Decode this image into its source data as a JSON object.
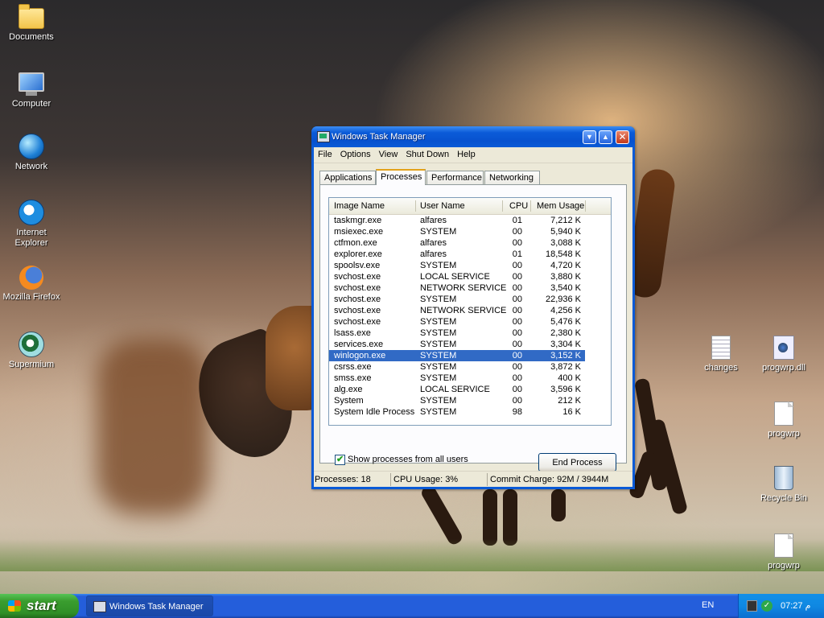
{
  "desktop": {
    "left_icons": [
      {
        "label": "Documents",
        "icon": "folder-icon"
      },
      {
        "label": "Computer",
        "icon": "computer-icon"
      },
      {
        "label": "Network",
        "icon": "network-icon"
      },
      {
        "label": "Internet Explorer",
        "icon": "internet-explorer-icon"
      },
      {
        "label": "Mozilla Firefox",
        "icon": "firefox-icon"
      },
      {
        "label": "Supermium",
        "icon": "supermium-icon"
      }
    ],
    "right_icons": [
      {
        "label": "changes",
        "icon": "text-document-icon"
      },
      {
        "label": "progwrp.dll",
        "icon": "dll-file-icon"
      },
      {
        "label": "progwrp",
        "icon": "document-icon"
      },
      {
        "label": "Recycle Bin",
        "icon": "recycle-bin-icon"
      },
      {
        "label": "progwrp",
        "icon": "document-icon"
      }
    ]
  },
  "window": {
    "title": "Windows Task Manager",
    "menu": [
      "File",
      "Options",
      "View",
      "Shut Down",
      "Help"
    ],
    "tabs": [
      "Applications",
      "Processes",
      "Performance",
      "Networking"
    ],
    "active_tab": "Processes",
    "columns": [
      "Image Name",
      "User Name",
      "CPU",
      "Mem Usage"
    ],
    "processes": [
      {
        "image": "taskmgr.exe",
        "user": "alfares",
        "cpu": "01",
        "mem": "7,212 K"
      },
      {
        "image": "msiexec.exe",
        "user": "SYSTEM",
        "cpu": "00",
        "mem": "5,940 K"
      },
      {
        "image": "ctfmon.exe",
        "user": "alfares",
        "cpu": "00",
        "mem": "3,088 K"
      },
      {
        "image": "explorer.exe",
        "user": "alfares",
        "cpu": "01",
        "mem": "18,548 K"
      },
      {
        "image": "spoolsv.exe",
        "user": "SYSTEM",
        "cpu": "00",
        "mem": "4,720 K"
      },
      {
        "image": "svchost.exe",
        "user": "LOCAL SERVICE",
        "cpu": "00",
        "mem": "3,880 K"
      },
      {
        "image": "svchost.exe",
        "user": "NETWORK SERVICE",
        "cpu": "00",
        "mem": "3,540 K"
      },
      {
        "image": "svchost.exe",
        "user": "SYSTEM",
        "cpu": "00",
        "mem": "22,936 K"
      },
      {
        "image": "svchost.exe",
        "user": "NETWORK SERVICE",
        "cpu": "00",
        "mem": "4,256 K"
      },
      {
        "image": "svchost.exe",
        "user": "SYSTEM",
        "cpu": "00",
        "mem": "5,476 K"
      },
      {
        "image": "lsass.exe",
        "user": "SYSTEM",
        "cpu": "00",
        "mem": "2,380 K"
      },
      {
        "image": "services.exe",
        "user": "SYSTEM",
        "cpu": "00",
        "mem": "3,304 K"
      },
      {
        "image": "winlogon.exe",
        "user": "SYSTEM",
        "cpu": "00",
        "mem": "3,152 K",
        "selected": true
      },
      {
        "image": "csrss.exe",
        "user": "SYSTEM",
        "cpu": "00",
        "mem": "3,872 K"
      },
      {
        "image": "smss.exe",
        "user": "SYSTEM",
        "cpu": "00",
        "mem": "400 K"
      },
      {
        "image": "alg.exe",
        "user": "LOCAL SERVICE",
        "cpu": "00",
        "mem": "3,596 K"
      },
      {
        "image": "System",
        "user": "SYSTEM",
        "cpu": "00",
        "mem": "212 K"
      },
      {
        "image": "System Idle Process",
        "user": "SYSTEM",
        "cpu": "98",
        "mem": "16 K"
      }
    ],
    "show_all_label": "Show processes from all users",
    "show_all_checked": true,
    "end_process_label": "End Process",
    "status": {
      "processes": "Processes: 18",
      "cpu": "CPU Usage: 3%",
      "commit": "Commit Charge: 92M / 3944M"
    }
  },
  "taskbar": {
    "start_label": "start",
    "task_label": "Windows Task Manager",
    "language": "EN",
    "clock": "07:27 م"
  }
}
